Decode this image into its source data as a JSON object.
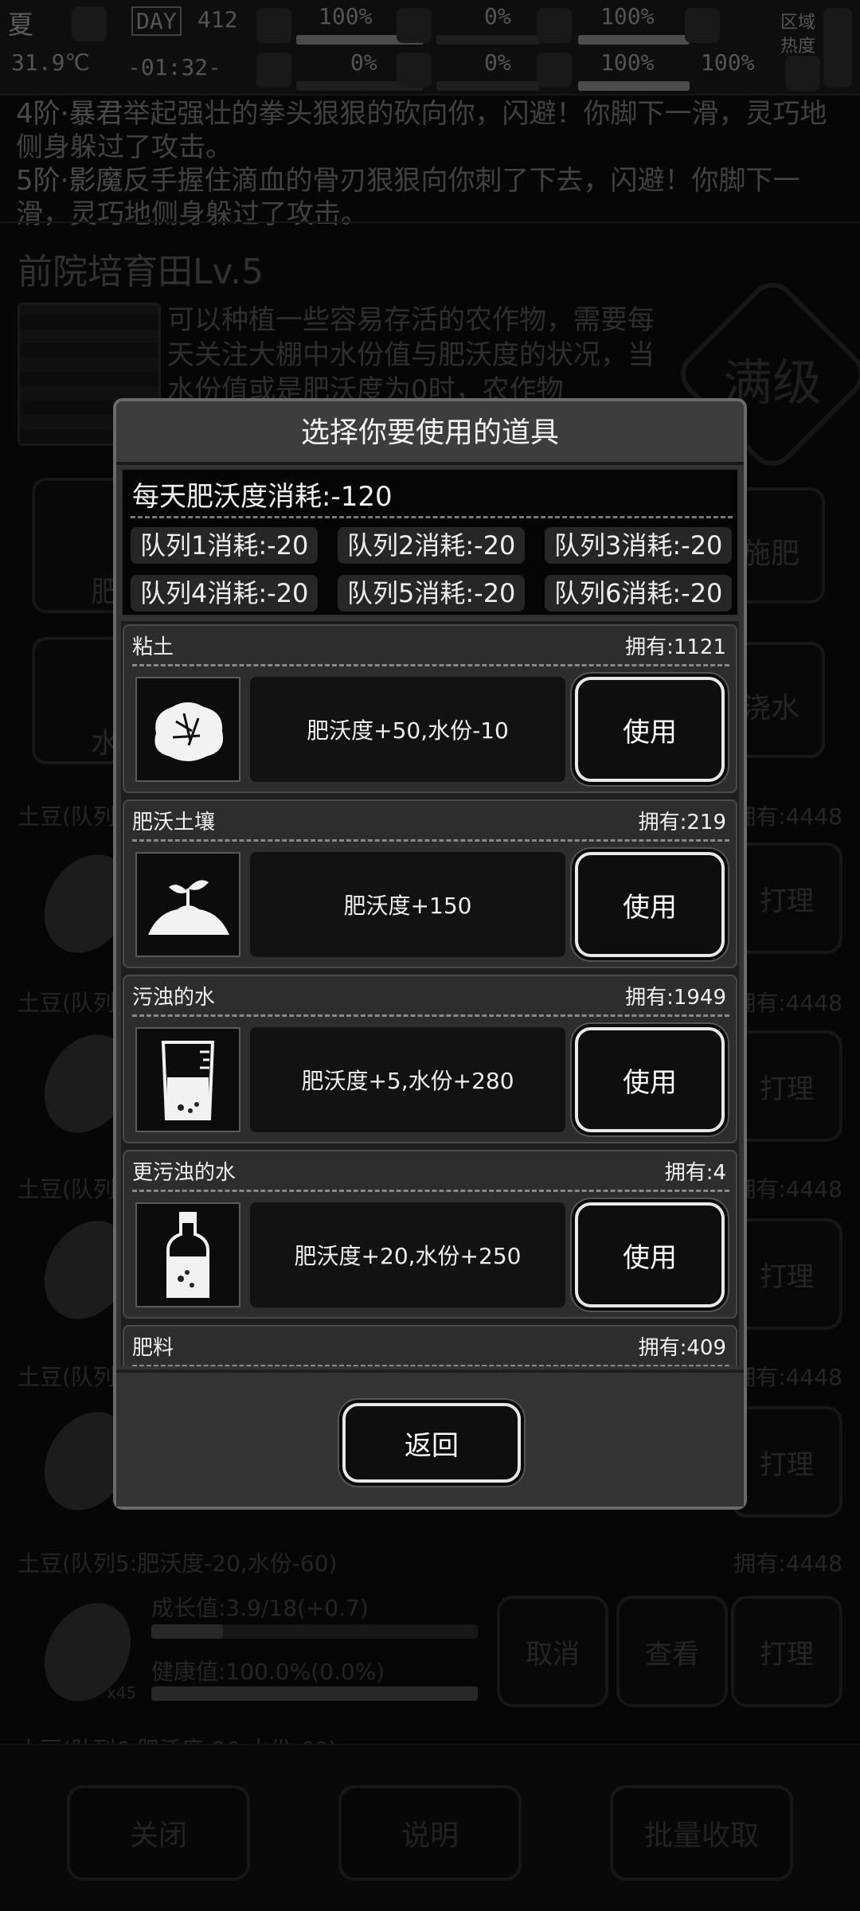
{
  "hud": {
    "season": "夏",
    "day_label": "DAY",
    "day_number": "412",
    "temperature": "31.9℃",
    "time": "-01:32-",
    "stat_1": "100%",
    "stat_2": "0%",
    "stat_3": "100%",
    "stat_4": "0%",
    "stat_5": "0%",
    "stat_6": "100%",
    "stat_7": "100%",
    "stat_8": "100%",
    "region_label": "区域",
    "heat_label": "热度"
  },
  "battle_log": [
    {
      "prefix": "4阶·暴君",
      "text": "举起强壮的拳头狠狠的砍向你，闪避！你脚下一滑，灵巧地侧身躲过了攻击。"
    },
    {
      "prefix": "5阶·影魔",
      "text": "反手握住滴血的骨刃狠狠向你刺了下去，闪避！你脚下一滑，灵巧地侧身躲过了攻击。"
    }
  ],
  "field": {
    "title": "前院培育田Lv.5",
    "description": "可以种植一些容易存活的农作物，需要每天关注大棚中水份值与肥沃度的状况，当水份值或是肥沃度为0时，农作物",
    "badge": "满级",
    "btn_fertilize_left": "肥沃",
    "btn_water_left": "水份",
    "btn_fertilize_right": "施肥",
    "btn_water_right": "浇水"
  },
  "rows": {
    "row1_head": "土豆(队列1",
    "row2_head": "土豆(队列",
    "row3_head": "土豆(队列",
    "row4_head": "土豆(队列",
    "row5_head": "土豆(队列5:肥沃度-20,水份-60)",
    "row6_head": "土豆(队列6:肥沃度-20,水份-60)",
    "own_prefix": "拥有:4448",
    "manage": "打理",
    "cancel": "取消",
    "view": "查看",
    "growth": "成长值:3.9/18(+0.7)",
    "health": "健康值:100.0%(0.0%)",
    "count": "x45"
  },
  "bottom": {
    "close": "关闭",
    "help": "说明",
    "harvest": "批量收取"
  },
  "modal": {
    "title": "选择你要使用的道具",
    "daily": "每天肥沃度消耗:-120",
    "queues": [
      "队列1消耗:-20",
      "队列2消耗:-20",
      "队列3消耗:-20",
      "队列4消耗:-20",
      "队列5消耗:-20",
      "队列6消耗:-20"
    ],
    "items": [
      {
        "name": "粘土",
        "own": "拥有:1121",
        "effect": "肥沃度+50,水份-10",
        "use": "使用"
      },
      {
        "name": "肥沃土壤",
        "own": "拥有:219",
        "effect": "肥沃度+150",
        "use": "使用"
      },
      {
        "name": "污浊的水",
        "own": "拥有:1949",
        "effect": "肥沃度+5,水份+280",
        "use": "使用"
      },
      {
        "name": "更污浊的水",
        "own": "拥有:4",
        "effect": "肥沃度+20,水份+250",
        "use": "使用"
      },
      {
        "name": "肥料",
        "own": "拥有:409"
      }
    ],
    "back": "返回"
  }
}
